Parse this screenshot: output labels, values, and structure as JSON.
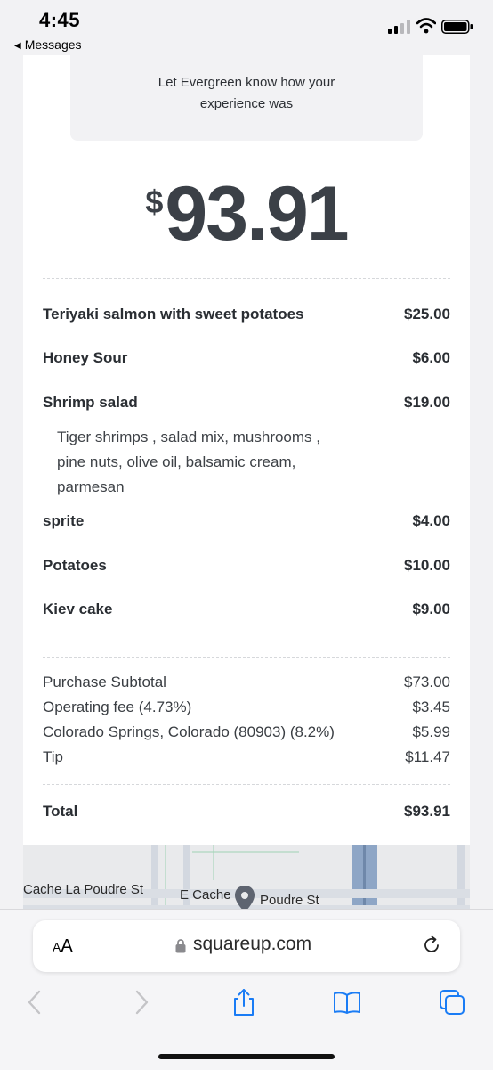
{
  "status_bar": {
    "time": "4:45",
    "back_app_label": "Messages"
  },
  "receipt": {
    "feedback_text_line1": "Let Evergreen know how your",
    "feedback_text_line2": "experience was",
    "amount_currency": "$",
    "amount_value": "93.91",
    "items": [
      {
        "name": "Teriyaki salmon with sweet potatoes",
        "price": "$25.00"
      },
      {
        "name": "Honey Sour",
        "price": "$6.00"
      },
      {
        "name": "Shrimp salad",
        "price": "$19.00",
        "description_lines": [
          "Tiger shrimps , salad mix, mushrooms ,",
          "pine nuts, olive oil, balsamic cream,",
          "parmesan"
        ]
      },
      {
        "name": "sprite",
        "price": "$4.00"
      },
      {
        "name": "Potatoes",
        "price": "$10.00"
      },
      {
        "name": "Kiev cake",
        "price": "$9.00"
      }
    ],
    "summary": [
      {
        "label": "Purchase Subtotal",
        "value": "$73.00"
      },
      {
        "label": "Operating fee (4.73%)",
        "value": "$3.45"
      },
      {
        "label": "Colorado Springs, Colorado (80903) (8.2%)",
        "value": "$5.99"
      },
      {
        "label": "Tip",
        "value": "$11.47"
      }
    ],
    "total": {
      "label": "Total",
      "value": "$93.91"
    }
  },
  "map": {
    "street_label_1": "Cache La Poudre St",
    "street_label_2": "E Cache",
    "street_label_3": "Poudre St"
  },
  "browser": {
    "text_size_label_small": "A",
    "text_size_label_large": "A",
    "url": "squareup.com",
    "icons": [
      "lock-icon",
      "reload-icon",
      "back-arrow-icon",
      "forward-arrow-icon",
      "share-icon",
      "bookmarks-icon",
      "tabs-icon"
    ]
  },
  "colors": {
    "amount_text": "#3b4047",
    "ios_blue": "#1a7cf5",
    "page_bg": "#f2f2f4"
  }
}
